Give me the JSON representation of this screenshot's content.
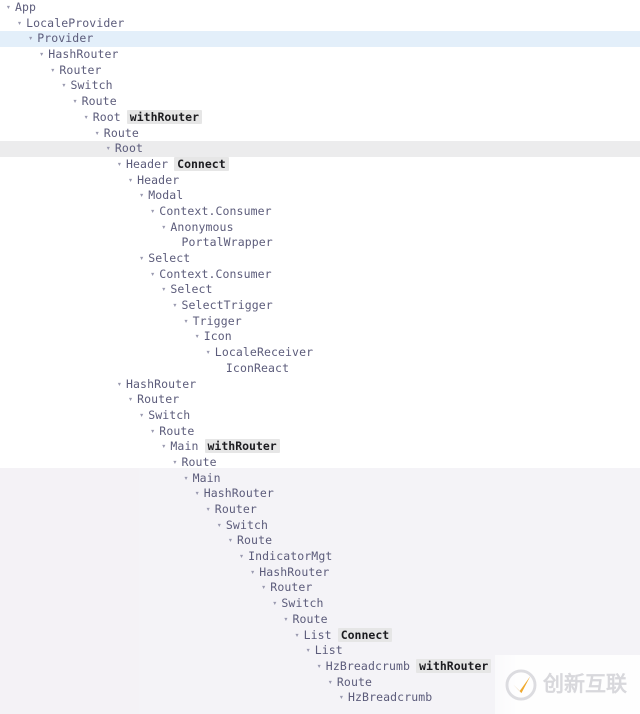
{
  "panel": {
    "name": "react-devtools-components-tree",
    "background_color": "#ffffff",
    "lower_background_color": "#f4f2f6",
    "text_color": "#5c5c7b",
    "selected_row_color": "#e3effa",
    "hovered_row_color": "#ececed",
    "badge_background_color": "#e6e6e6",
    "badge_text_color": "#1c1c20",
    "arrow_icon": "▾"
  },
  "watermark": {
    "text": "创新互联",
    "logo_icon": "circle-check-logo-icon",
    "ring_color": "#dcdce0",
    "swoosh_color": "#f0a92c",
    "text_color": "#d8d8dc"
  },
  "tree": {
    "rows": [
      {
        "label": "App",
        "depth": 0,
        "arrow": "▾",
        "badge": "",
        "state": "normal"
      },
      {
        "label": "LocaleProvider",
        "depth": 1,
        "arrow": "▾",
        "badge": "",
        "state": "normal"
      },
      {
        "label": "Provider",
        "depth": 2,
        "arrow": "▾",
        "badge": "",
        "state": "selected"
      },
      {
        "label": "HashRouter",
        "depth": 3,
        "arrow": "▾",
        "badge": "",
        "state": "normal"
      },
      {
        "label": "Router",
        "depth": 4,
        "arrow": "▾",
        "badge": "",
        "state": "normal"
      },
      {
        "label": "Switch",
        "depth": 5,
        "arrow": "▾",
        "badge": "",
        "state": "normal"
      },
      {
        "label": "Route",
        "depth": 6,
        "arrow": "▾",
        "badge": "",
        "state": "normal"
      },
      {
        "label": "Root",
        "depth": 7,
        "arrow": "▾",
        "badge": "withRouter",
        "state": "normal"
      },
      {
        "label": "Route",
        "depth": 8,
        "arrow": "▾",
        "badge": "",
        "state": "normal"
      },
      {
        "label": "Root",
        "depth": 9,
        "arrow": "▾",
        "badge": "",
        "state": "hovered"
      },
      {
        "label": "Header",
        "depth": 10,
        "arrow": "▾",
        "badge": "Connect",
        "state": "normal"
      },
      {
        "label": "Header",
        "depth": 11,
        "arrow": "▾",
        "badge": "",
        "state": "normal"
      },
      {
        "label": "Modal",
        "depth": 12,
        "arrow": "▾",
        "badge": "",
        "state": "normal"
      },
      {
        "label": "Context.Consumer",
        "depth": 13,
        "arrow": "▾",
        "badge": "",
        "state": "normal"
      },
      {
        "label": "Anonymous",
        "depth": 14,
        "arrow": "▾",
        "badge": "",
        "state": "normal"
      },
      {
        "label": "PortalWrapper",
        "depth": 15,
        "arrow": "",
        "badge": "",
        "state": "normal"
      },
      {
        "label": "Select",
        "depth": 12,
        "arrow": "▾",
        "badge": "",
        "state": "normal"
      },
      {
        "label": "Context.Consumer",
        "depth": 13,
        "arrow": "▾",
        "badge": "",
        "state": "normal"
      },
      {
        "label": "Select",
        "depth": 14,
        "arrow": "▾",
        "badge": "",
        "state": "normal"
      },
      {
        "label": "SelectTrigger",
        "depth": 15,
        "arrow": "▾",
        "badge": "",
        "state": "normal"
      },
      {
        "label": "Trigger",
        "depth": 16,
        "arrow": "▾",
        "badge": "",
        "state": "normal"
      },
      {
        "label": "Icon",
        "depth": 17,
        "arrow": "▾",
        "badge": "",
        "state": "normal"
      },
      {
        "label": "LocaleReceiver",
        "depth": 18,
        "arrow": "▾",
        "badge": "",
        "state": "normal"
      },
      {
        "label": "IconReact",
        "depth": 19,
        "arrow": "",
        "badge": "",
        "state": "normal"
      },
      {
        "label": "HashRouter",
        "depth": 10,
        "arrow": "▾",
        "badge": "",
        "state": "normal"
      },
      {
        "label": "Router",
        "depth": 11,
        "arrow": "▾",
        "badge": "",
        "state": "normal"
      },
      {
        "label": "Switch",
        "depth": 12,
        "arrow": "▾",
        "badge": "",
        "state": "normal"
      },
      {
        "label": "Route",
        "depth": 13,
        "arrow": "▾",
        "badge": "",
        "state": "normal"
      },
      {
        "label": "Main",
        "depth": 14,
        "arrow": "▾",
        "badge": "withRouter",
        "state": "normal"
      },
      {
        "label": "Route",
        "depth": 15,
        "arrow": "▾",
        "badge": "",
        "state": "normal"
      },
      {
        "label": "Main",
        "depth": 16,
        "arrow": "▾",
        "badge": "",
        "state": "normal"
      },
      {
        "label": "HashRouter",
        "depth": 17,
        "arrow": "▾",
        "badge": "",
        "state": "normal"
      },
      {
        "label": "Router",
        "depth": 18,
        "arrow": "▾",
        "badge": "",
        "state": "normal"
      },
      {
        "label": "Switch",
        "depth": 19,
        "arrow": "▾",
        "badge": "",
        "state": "normal"
      },
      {
        "label": "Route",
        "depth": 20,
        "arrow": "▾",
        "badge": "",
        "state": "normal"
      },
      {
        "label": "IndicatorMgt",
        "depth": 21,
        "arrow": "▾",
        "badge": "",
        "state": "normal"
      },
      {
        "label": "HashRouter",
        "depth": 22,
        "arrow": "▾",
        "badge": "",
        "state": "normal"
      },
      {
        "label": "Router",
        "depth": 23,
        "arrow": "▾",
        "badge": "",
        "state": "normal"
      },
      {
        "label": "Switch",
        "depth": 24,
        "arrow": "▾",
        "badge": "",
        "state": "normal"
      },
      {
        "label": "Route",
        "depth": 25,
        "arrow": "▾",
        "badge": "",
        "state": "normal"
      },
      {
        "label": "List",
        "depth": 26,
        "arrow": "▾",
        "badge": "Connect",
        "state": "normal"
      },
      {
        "label": "List",
        "depth": 27,
        "arrow": "▾",
        "badge": "",
        "state": "normal"
      },
      {
        "label": "HzBreadcrumb",
        "depth": 28,
        "arrow": "▾",
        "badge": "withRouter",
        "state": "normal"
      },
      {
        "label": "Route",
        "depth": 29,
        "arrow": "▾",
        "badge": "",
        "state": "normal"
      },
      {
        "label": "HzBreadcrumb",
        "depth": 30,
        "arrow": "▾",
        "badge": "",
        "state": "normal"
      }
    ]
  }
}
